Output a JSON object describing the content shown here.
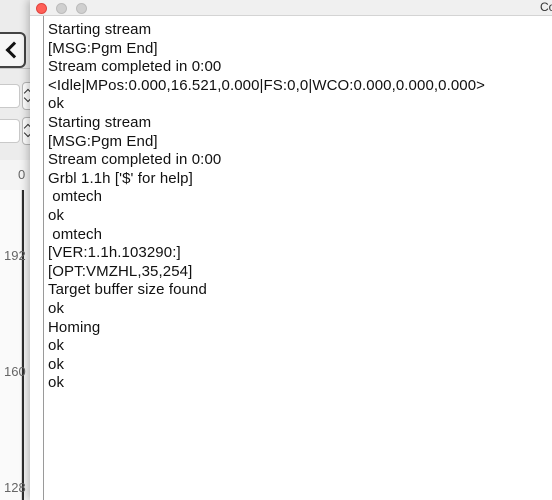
{
  "window": {
    "title": "Co"
  },
  "background_app": {
    "ruler_labels": [
      "0",
      "192",
      "160",
      "128"
    ]
  },
  "console": {
    "lines": [
      "Starting stream",
      "[MSG:Pgm End]",
      "Stream completed in 0:00",
      "<Idle|MPos:0.000,16.521,0.000|FS:0,0|WCO:0.000,0.000,0.000>",
      "ok",
      "Starting stream",
      "[MSG:Pgm End]",
      "Stream completed in 0:00",
      "Grbl 1.1h ['$' for help]",
      " omtech",
      "ok",
      " omtech",
      "[VER:1.1h.103290:]",
      "[OPT:VMZHL,35,254]",
      "Target buffer size found",
      "ok",
      "Homing",
      "ok",
      "ok",
      "ok"
    ]
  },
  "colors": {
    "close_button": "#ff5f57",
    "inactive_button": "#cfcfcf"
  }
}
